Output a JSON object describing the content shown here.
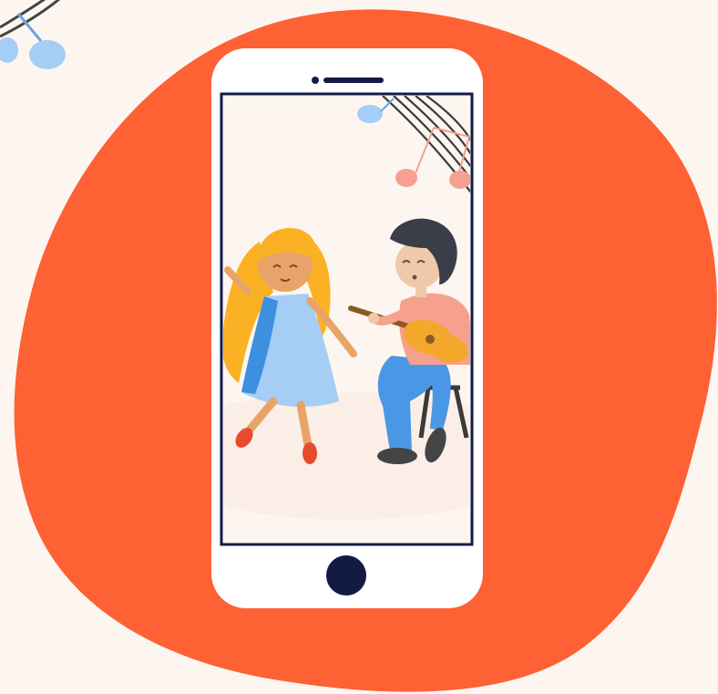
{
  "colors": {
    "page_background": "#fdf6f0",
    "blob": "#fe6134",
    "phone_body": "#ffffff",
    "phone_bezel": "#131b45",
    "screen_background": "#fdf6f0",
    "note_blue": "#a5cdf6",
    "note_pink": "#f5a090",
    "staff_lines": "#333333",
    "girl_hair": "#fbb124",
    "girl_dress": "#a5cdf6",
    "girl_dress_shade": "#3d8fe0",
    "skin": "#e8a468",
    "shoe": "#e64b2e",
    "boy_hair": "#3b3e49",
    "boy_shirt": "#f6a08e",
    "boy_pants": "#4a97e6",
    "guitar": "#f3a82c",
    "stool": "#333333"
  },
  "icons": {
    "home_button": "home-button-icon",
    "speaker": "earpiece-speaker-icon",
    "camera": "front-camera-icon",
    "music_note": "music-note-icon"
  },
  "illustration": {
    "scene": "girl-dancing-boy-playing-guitar"
  }
}
